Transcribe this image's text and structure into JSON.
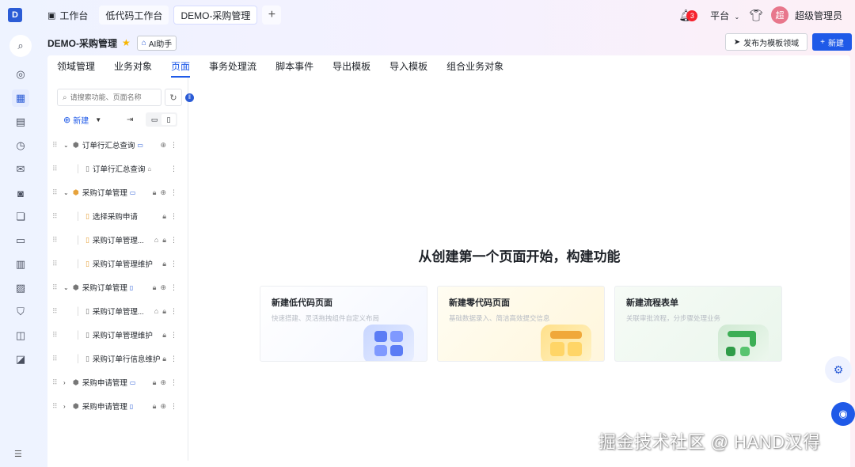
{
  "topbar": {
    "logo_letter": "D",
    "tabs": [
      {
        "label": "工作台"
      },
      {
        "label": "低代码工作台"
      },
      {
        "label": "DEMO-采购管理"
      }
    ],
    "add_tab": "+",
    "notification_count": "3",
    "platform_label": "平台",
    "avatar_text": "超",
    "user_name": "超级管理员"
  },
  "page": {
    "title": "DEMO-采购管理",
    "ai_assistant": "AI助手",
    "publish_button": "发布为模板领域",
    "new_button": "新建"
  },
  "nav_tabs": [
    "领域管理",
    "业务对象",
    "页面",
    "事务处理流",
    "脚本事件",
    "导出模板",
    "导入模板",
    "组合业务对象"
  ],
  "tree": {
    "search_placeholder": "请搜索功能、页面名称",
    "new_label": "新建",
    "rows": [
      {
        "label": "订单行汇总查询"
      },
      {
        "label": "订单行汇总查询"
      },
      {
        "label": "采购订单管理"
      },
      {
        "label": "选择采购申请"
      },
      {
        "label": "采购订单管理..."
      },
      {
        "label": "采购订单管理维护"
      },
      {
        "label": "采购订单管理"
      },
      {
        "label": "采购订单管理..."
      },
      {
        "label": "采购订单管理维护"
      },
      {
        "label": "采购订单行信息维护"
      },
      {
        "label": "采购申请管理"
      },
      {
        "label": "采购申请管理"
      }
    ]
  },
  "empty_state": {
    "title": "从创建第一个页面开始，构建功能",
    "cards": [
      {
        "title": "新建低代码页面",
        "desc": "快速搭建、灵活拖拽组件自定义布局"
      },
      {
        "title": "新建零代码页面",
        "desc": "基础数据录入、简洁高效提交信息"
      },
      {
        "title": "新建流程表单",
        "desc": "关联审批流程，分步骤处理业务"
      }
    ]
  },
  "watermark": "掘金技术社区 @ HAND汉得"
}
